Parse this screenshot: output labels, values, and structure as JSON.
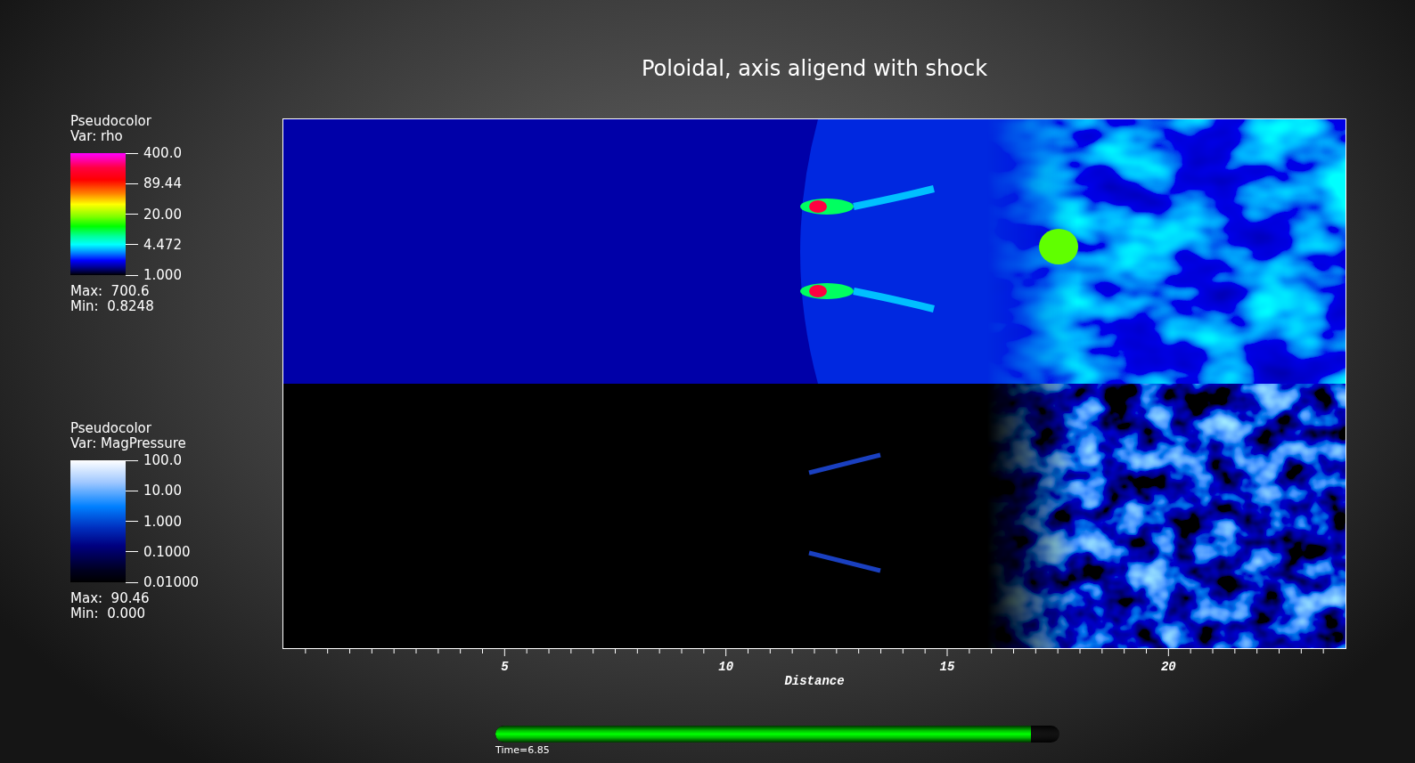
{
  "title": "Poloidal, axis aligend with shock",
  "legends": [
    {
      "kind": "rainbow",
      "heading": "Pseudocolor",
      "variable": "Var: rho",
      "ticks": [
        "400.0",
        "89.44",
        "20.00",
        "4.472",
        "1.000"
      ],
      "max": "Max:  700.6",
      "min": "Min:  0.8248"
    },
    {
      "kind": "blue",
      "heading": "Pseudocolor",
      "variable": "Var: MagPressure",
      "ticks": [
        "100.0",
        "10.00",
        "1.000",
        "0.1000",
        "0.01000"
      ],
      "max": "Max:  90.46",
      "min": "Min:  0.000"
    }
  ],
  "x_axis": {
    "title": "Distance",
    "ticks": [
      "5",
      "10",
      "15",
      "20"
    ]
  },
  "time_slider": {
    "level": 0.95,
    "label": "Time=6.85"
  }
}
